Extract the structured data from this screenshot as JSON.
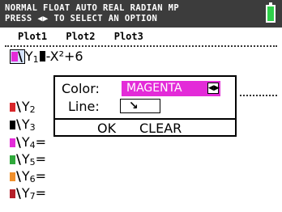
{
  "status": {
    "line1": "NORMAL FLOAT AUTO REAL RADIAN MP",
    "line2": "PRESS ◀▶ TO SELECT AN OPTION",
    "bar_color": "#3c3c3c",
    "battery_color": "#2fd04a"
  },
  "plots": [
    "Plot1",
    "Plot2",
    "Plot3"
  ],
  "equations": [
    {
      "name": "Y",
      "sub": "1",
      "eq": "-X²+6",
      "color": "#e32bd8"
    },
    {
      "name": "Y",
      "sub": "2",
      "eq": "",
      "color": "#d8262a"
    },
    {
      "name": "Y",
      "sub": "3",
      "eq": "",
      "color": "#000000"
    },
    {
      "name": "Y",
      "sub": "4",
      "eq": "=",
      "color": "#e32bd8"
    },
    {
      "name": "Y",
      "sub": "5",
      "eq": "=",
      "color": "#2fa83b"
    },
    {
      "name": "Y",
      "sub": "6",
      "eq": "=",
      "color": "#f0902c"
    },
    {
      "name": "Y",
      "sub": "7",
      "eq": "=",
      "color": "#b5202a"
    }
  ],
  "dialog": {
    "color_label": "Color:",
    "color_value": "MAGENTA",
    "color_value_bg": "#e32bd8",
    "arrows": "◀▶",
    "line_label": "Line:",
    "line_value": "↘",
    "ok_label": "OK",
    "clear_label": "CLEAR"
  }
}
